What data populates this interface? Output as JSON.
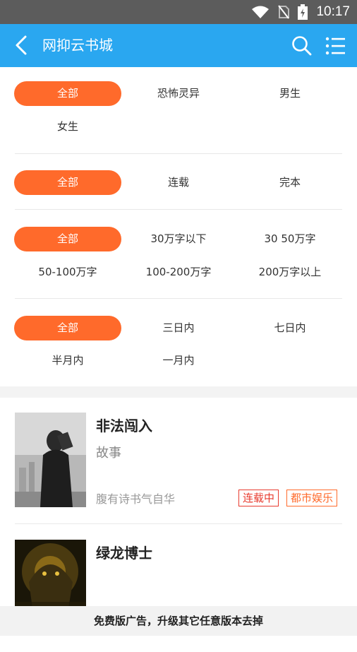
{
  "status_bar": {
    "time": "10:17",
    "icons": [
      "wifi-icon",
      "no-sim-icon",
      "battery-charging-icon"
    ]
  },
  "header": {
    "title": "网抑云书城",
    "icons": [
      "back-icon",
      "search-icon",
      "list-menu-icon"
    ],
    "bg_color": "#2aa7f0"
  },
  "accent_color": "#ff6a2b",
  "filters": [
    {
      "options": [
        "全部",
        "恐怖灵异",
        "男生",
        "女生"
      ],
      "selected": "全部"
    },
    {
      "options": [
        "全部",
        "连载",
        "完本"
      ],
      "selected": "全部"
    },
    {
      "options": [
        "全部",
        "30万字以下",
        "30 50万字",
        "50-100万字",
        "100-200万字",
        "200万字以上"
      ],
      "selected": "全部"
    },
    {
      "options": [
        "全部",
        "三日内",
        "七日内",
        "半月内",
        "一月内"
      ],
      "selected": "全部"
    }
  ],
  "books": [
    {
      "title": "非法闯入",
      "desc": "故事",
      "author": "腹有诗书气自华",
      "tags": [
        "连载中",
        "都市娱乐"
      ]
    },
    {
      "title": "绿龙博士",
      "desc": "",
      "author": "",
      "tags": []
    }
  ],
  "ad_banner": "免费版广告，升级其它任意版本去掉"
}
